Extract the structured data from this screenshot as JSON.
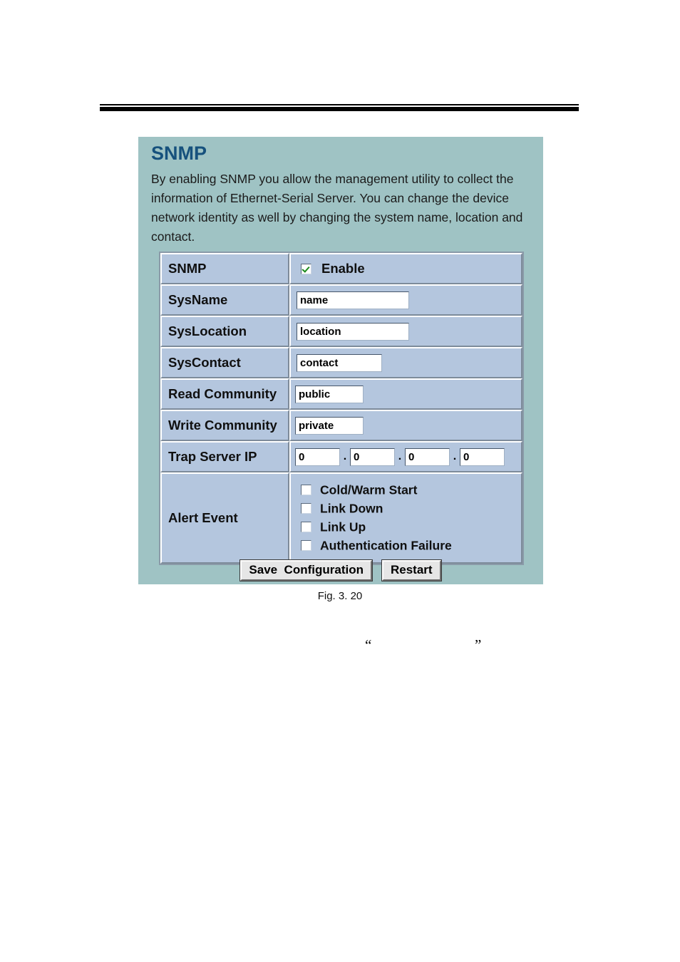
{
  "page": {
    "figure_caption": "Fig. 3. 20",
    "stray_quote_open": "“",
    "stray_quote_close": "”"
  },
  "panel": {
    "title": "SNMP",
    "description": "By enabling SNMP you allow the management utility to collect the information of Ethernet-Serial Server. You can change the device network identity as well by changing the system name, location and contact.",
    "colors": {
      "panel_background": "#9fc3c4",
      "title": "#16517d",
      "cell_background": "#b4c6de",
      "checkmark": "#1a8a1a"
    }
  },
  "form": {
    "rows": {
      "snmp": {
        "label": "SNMP",
        "enable_label": "Enable",
        "enabled": true
      },
      "sysname": {
        "label": "SysName",
        "value": "name"
      },
      "syslocation": {
        "label": "SysLocation",
        "value": "location"
      },
      "syscontact": {
        "label": "SysContact",
        "value": "contact"
      },
      "read_community": {
        "label": "Read Community",
        "value": "public"
      },
      "write_community": {
        "label": "Write Community",
        "value": "private"
      },
      "trap_server_ip": {
        "label": "Trap Server IP",
        "separator": ".",
        "octets": [
          "0",
          "0",
          "0",
          "0"
        ]
      },
      "alert_event": {
        "label": "Alert Event",
        "events": [
          {
            "label": "Cold/Warm Start",
            "checked": false
          },
          {
            "label": "Link Down",
            "checked": false
          },
          {
            "label": "Link Up",
            "checked": false
          },
          {
            "label": "Authentication Failure",
            "checked": false
          }
        ]
      }
    }
  },
  "buttons": {
    "save": "Save  Configuration",
    "restart": "Restart"
  }
}
